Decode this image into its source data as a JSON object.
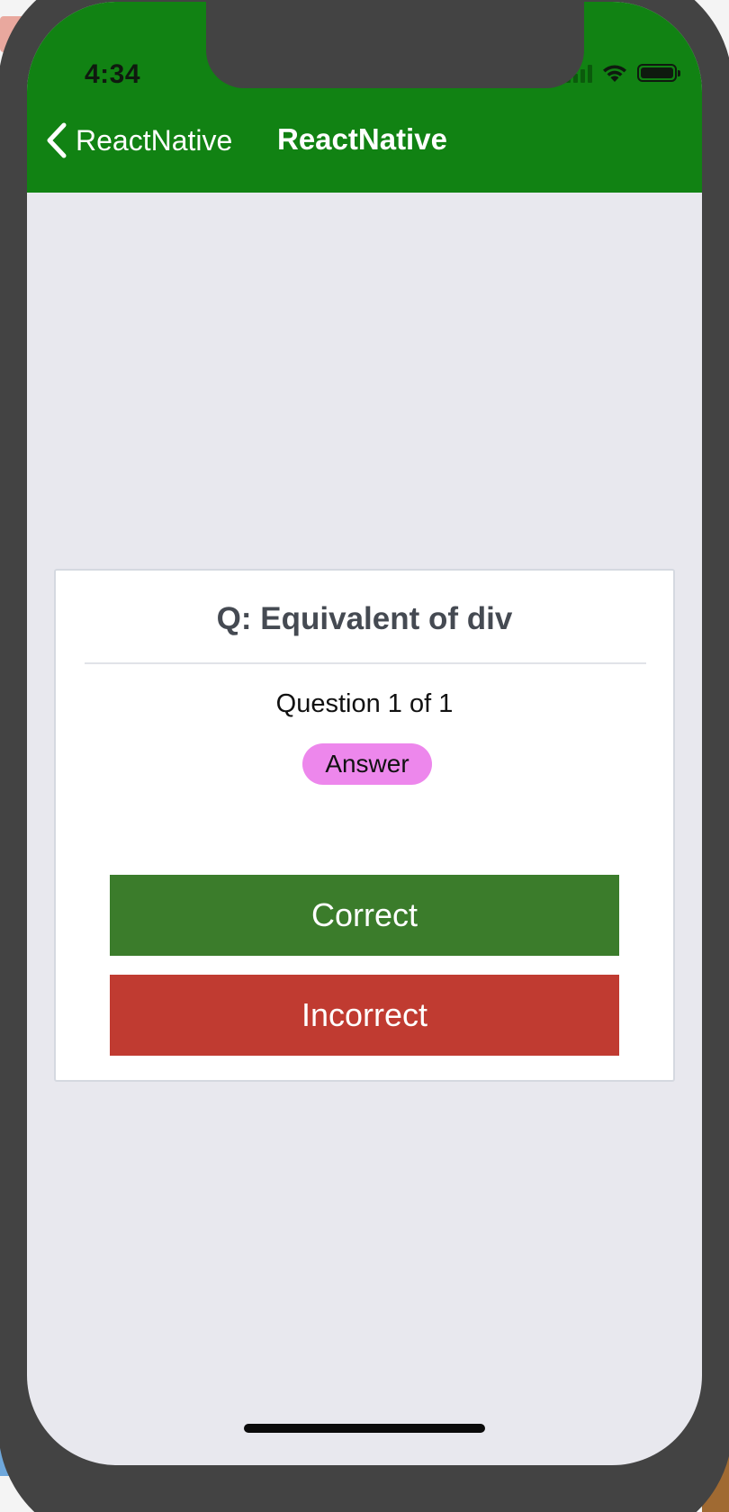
{
  "status_bar": {
    "time": "4:34",
    "signal_icon": "cellular-signal",
    "wifi_icon": "wifi",
    "battery_icon": "battery-full"
  },
  "nav": {
    "back_label": "ReactNative",
    "back_icon": "chevron-left",
    "title": "ReactNative",
    "background_color": "#118213"
  },
  "card": {
    "question": "Q: Equivalent of div",
    "progress": "Question 1 of 1",
    "answer_label": "Answer",
    "answer_color": "#ED87EC",
    "correct_label": "Correct",
    "correct_color": "#3B7C2B",
    "incorrect_label": "Incorrect",
    "incorrect_color": "#C03B31"
  }
}
